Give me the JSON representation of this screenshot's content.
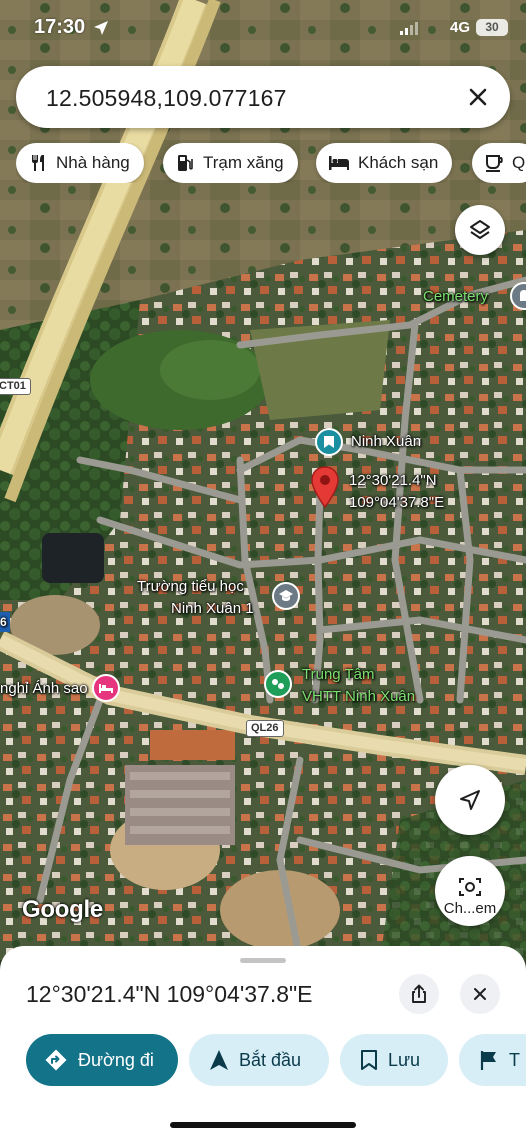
{
  "status_bar": {
    "time": "17:30",
    "network": "4G",
    "battery": "30"
  },
  "search": {
    "query": "12.505948,109.077167"
  },
  "chips": [
    {
      "label": "Nhà hàng",
      "icon": "restaurant-icon"
    },
    {
      "label": "Trạm xăng",
      "icon": "gas-station-icon"
    },
    {
      "label": "Khách sạn",
      "icon": "hotel-icon"
    },
    {
      "label": "Q",
      "icon": "coffee-icon"
    }
  ],
  "map": {
    "labels": {
      "cemetery": "Cemetery",
      "ninh_xuan": "Ninh Xuân",
      "pin_lat": "12°30'21.4\"N",
      "pin_lng": "109°04'37.8\"E",
      "school_line1": "Trường tiểu học",
      "school_line2": "Ninh Xuân 1",
      "center_line1": "Trung Tâm",
      "center_line2": "VHTT Ninh Xuân",
      "hotel": "nghỉ Ánh sao",
      "road_ql26": "QL26",
      "road_ct01": "CT01",
      "road_edge": "6"
    },
    "camera_label": "Ch...em",
    "attribution": "Google"
  },
  "sheet": {
    "coordinates": "12°30'21.4\"N 109°04'37.8\"E",
    "actions": [
      {
        "label": "Đường đi",
        "icon": "directions-icon",
        "primary": true
      },
      {
        "label": "Bắt đầu",
        "icon": "navigation-arrow-icon"
      },
      {
        "label": "Lưu",
        "icon": "bookmark-icon"
      },
      {
        "label": "T",
        "icon": "flag-icon"
      }
    ]
  },
  "colors": {
    "accent": "#137389",
    "action_bg": "#d7eef7",
    "pin": "#e53935",
    "poi_teal": "#1a8fa0",
    "poi_green": "#1e9e59",
    "poi_pink": "#e6357e",
    "poi_gray": "#6c7a85"
  }
}
